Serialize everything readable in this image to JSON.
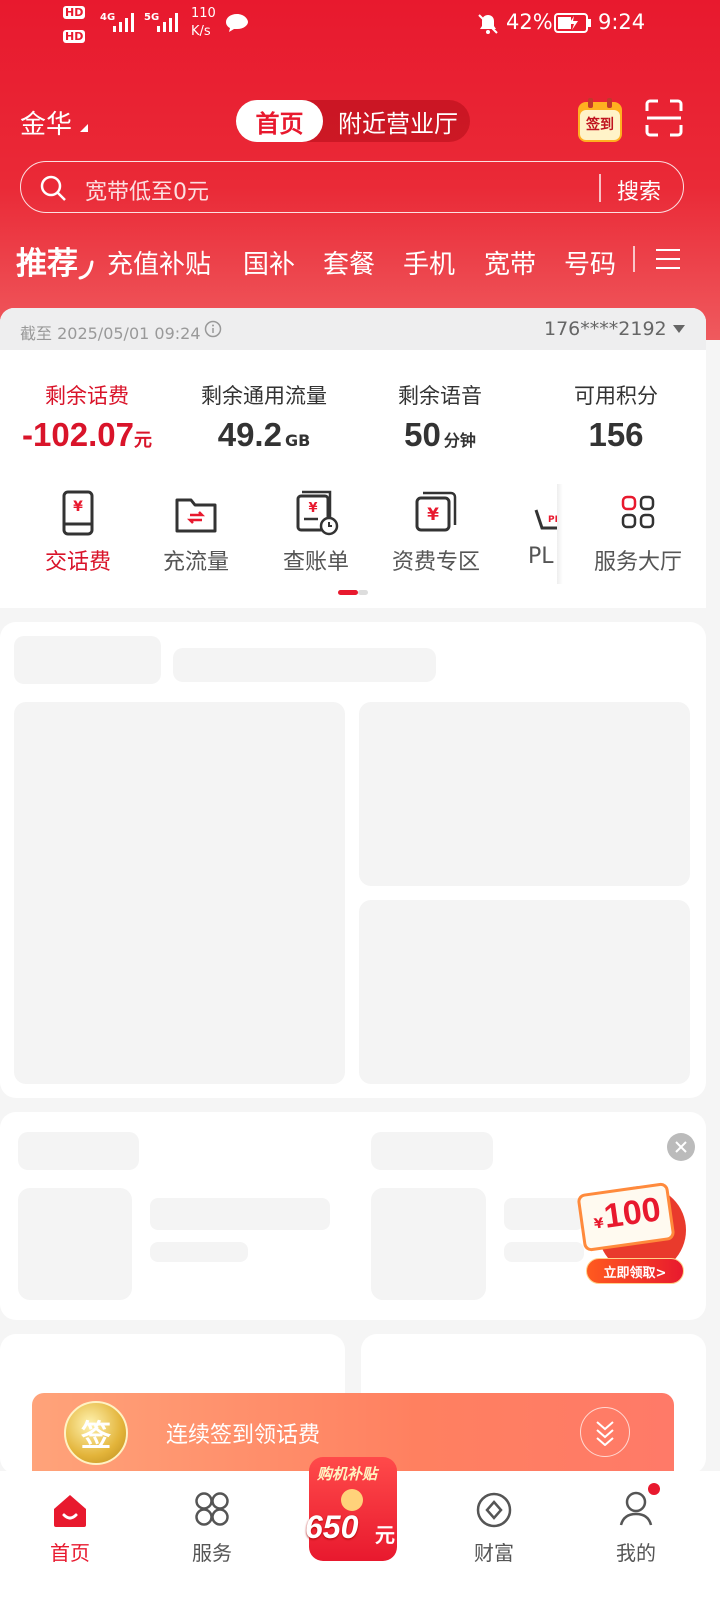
{
  "status_bar": {
    "hd1": "HD",
    "hd2": "HD",
    "net1": "4G",
    "net2": "5G",
    "speed_value": "110",
    "speed_unit": "K/s",
    "battery": "42%",
    "time": "9:24"
  },
  "header": {
    "city": "金华",
    "tabs": [
      "首页",
      "附近营业厅"
    ],
    "signin_badge": "签到",
    "search_placeholder": "宽带低至0元",
    "search_button": "搜索"
  },
  "categories": [
    "推荐",
    "充值补贴",
    "国补",
    "套餐",
    "手机",
    "宽带",
    "号码"
  ],
  "account": {
    "as_of": "截至 2025/05/01 09:24",
    "phone": "176****2192",
    "stats": [
      {
        "label": "剩余话费",
        "value": "-102.07",
        "unit": "元"
      },
      {
        "label": "剩余通用流量",
        "value": "49.2",
        "unit": "GB"
      },
      {
        "label": "剩余语音",
        "value": "50",
        "unit": "分钟"
      },
      {
        "label": "可用积分",
        "value": "156",
        "unit": ""
      }
    ],
    "quick_actions": [
      "交话费",
      "充流量",
      "查账单",
      "资费专区",
      "PL",
      "服务大厅"
    ]
  },
  "promo": {
    "amount": "100",
    "currency": "¥",
    "cta": "立即领取>"
  },
  "signin_banner": {
    "badge": "签",
    "text": "连续签到领话费"
  },
  "bottom_nav": {
    "items": [
      "首页",
      "服务",
      "财富",
      "我的"
    ],
    "center_title": "购机补贴",
    "center_amount": "650",
    "center_unit": "元"
  },
  "colors": {
    "brand_red": "#e8192e",
    "price_red": "#d9142a",
    "text_dark": "#333333"
  }
}
